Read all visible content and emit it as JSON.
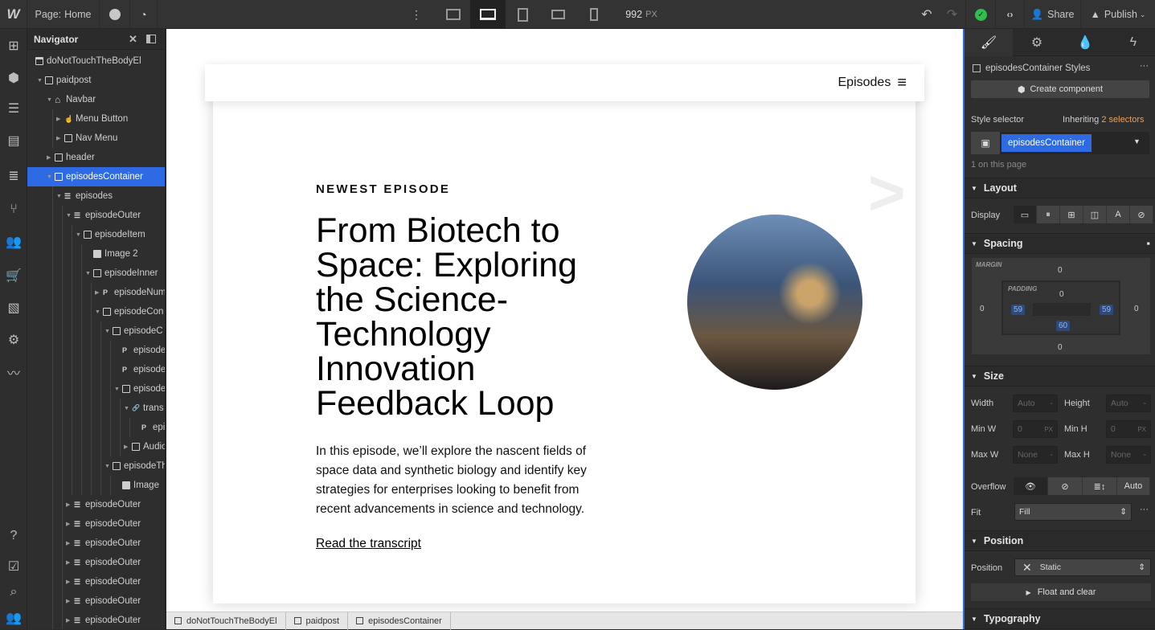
{
  "topbar": {
    "logo": "W",
    "page_label": "Page:",
    "page_name": "Home",
    "width_value": "992",
    "width_unit": "PX",
    "share": "Share",
    "publish": "Publish"
  },
  "navigator": {
    "title": "Navigator",
    "items": [
      {
        "label": "doNotTouchTheBodyEl",
        "level": 0,
        "icon": "body"
      },
      {
        "label": "paidpost",
        "level": 1,
        "icon": "box",
        "caret": "down"
      },
      {
        "label": "Navbar",
        "level": 2,
        "icon": "home",
        "caret": "down"
      },
      {
        "label": "Menu Button",
        "level": 3,
        "icon": "hand",
        "caret": "right"
      },
      {
        "label": "Nav Menu",
        "level": 3,
        "icon": "box",
        "caret": "right"
      },
      {
        "label": "header",
        "level": 2,
        "icon": "box",
        "caret": "right"
      },
      {
        "label": "episodesContainer",
        "level": 2,
        "icon": "box",
        "caret": "down",
        "selected": true
      },
      {
        "label": "episodes",
        "level": 3,
        "icon": "list",
        "caret": "down"
      },
      {
        "label": "episodeOuter",
        "level": 4,
        "icon": "list",
        "caret": "down"
      },
      {
        "label": "episodeItem",
        "level": 5,
        "icon": "box",
        "caret": "down"
      },
      {
        "label": "Image 2",
        "level": 6,
        "icon": "image"
      },
      {
        "label": "episodeInner",
        "level": 6,
        "icon": "box",
        "caret": "down"
      },
      {
        "label": "episodeNum",
        "level": 7,
        "icon": "paragraph",
        "caret": "right"
      },
      {
        "label": "episodeCon",
        "level": 7,
        "icon": "box",
        "caret": "down"
      },
      {
        "label": "episodeC",
        "level": 8,
        "icon": "box",
        "caret": "down"
      },
      {
        "label": "episode",
        "level": 9,
        "icon": "paragraph"
      },
      {
        "label": "episode",
        "level": 9,
        "icon": "paragraph"
      },
      {
        "label": "episode",
        "level": 9,
        "icon": "box",
        "caret": "down"
      },
      {
        "label": "trans",
        "level": 10,
        "icon": "link",
        "caret": "down"
      },
      {
        "label": "epi",
        "level": 11,
        "icon": "paragraph"
      },
      {
        "label": "Audio",
        "level": 10,
        "icon": "box",
        "caret": "right"
      },
      {
        "label": "episodeTh",
        "level": 8,
        "icon": "box",
        "caret": "down"
      },
      {
        "label": "Image",
        "level": 9,
        "icon": "image"
      },
      {
        "label": "episodeOuter",
        "level": 4,
        "icon": "list",
        "caret": "right"
      },
      {
        "label": "episodeOuter",
        "level": 4,
        "icon": "list",
        "caret": "right"
      },
      {
        "label": "episodeOuter",
        "level": 4,
        "icon": "list",
        "caret": "right"
      },
      {
        "label": "episodeOuter",
        "level": 4,
        "icon": "list",
        "caret": "right"
      },
      {
        "label": "episodeOuter",
        "level": 4,
        "icon": "list",
        "caret": "right"
      },
      {
        "label": "episodeOuter",
        "level": 4,
        "icon": "list",
        "caret": "right"
      },
      {
        "label": "episodeOuter",
        "level": 4,
        "icon": "list",
        "caret": "right"
      }
    ]
  },
  "canvas": {
    "nav_link": "Episodes",
    "eyebrow": "NEWEST EPISODE",
    "headline": "From Biotech to Space: Exploring the Science-Technology Innovation Feedback Loop",
    "description": "In this episode, we’ll explore the nascent fields of space data and synthetic biology and identify key strategies for enterprises looking to benefit from recent advancements in science and technology.",
    "link": "Read the transcript",
    "arrow": ">"
  },
  "breadcrumbs": [
    "doNotTouchTheBodyEl",
    "paidpost",
    "episodesContainer"
  ],
  "style_panel": {
    "styles_title": "episodesContainer Styles",
    "create_component": "Create component",
    "style_selector_label": "Style selector",
    "inheriting": "Inheriting",
    "inheriting_count": "2 selectors",
    "selector": "episodesContainer",
    "on_page": "1 on this page",
    "layout": {
      "title": "Layout",
      "display_label": "Display",
      "display_value": "block"
    },
    "spacing": {
      "title": "Spacing",
      "margin_label": "MARGIN",
      "padding_label": "PADDING",
      "margin": {
        "top": "0",
        "right": "0",
        "bottom": "0",
        "left": "0"
      },
      "padding": {
        "top": "0",
        "right": "59",
        "bottom": "60",
        "left": "59"
      }
    },
    "size": {
      "title": "Size",
      "width_label": "Width",
      "width": "Auto",
      "height_label": "Height",
      "height": "Auto",
      "minw_label": "Min W",
      "minw": "0",
      "minh_label": "Min H",
      "minh": "0",
      "maxw_label": "Max W",
      "maxw": "None",
      "maxh_label": "Max H",
      "maxh": "None",
      "unit": "PX",
      "dash": "-",
      "overflow_label": "Overflow",
      "overflow_auto": "Auto",
      "fit_label": "Fit",
      "fit": "Fill"
    },
    "position": {
      "title": "Position",
      "label": "Position",
      "value": "Static",
      "float": "Float and clear"
    },
    "typography": {
      "title": "Typography"
    }
  },
  "colors": {
    "accent": "#2d6ae3",
    "selector_highlight": "#e8a15a",
    "status_ok": "#2fbf4f"
  }
}
